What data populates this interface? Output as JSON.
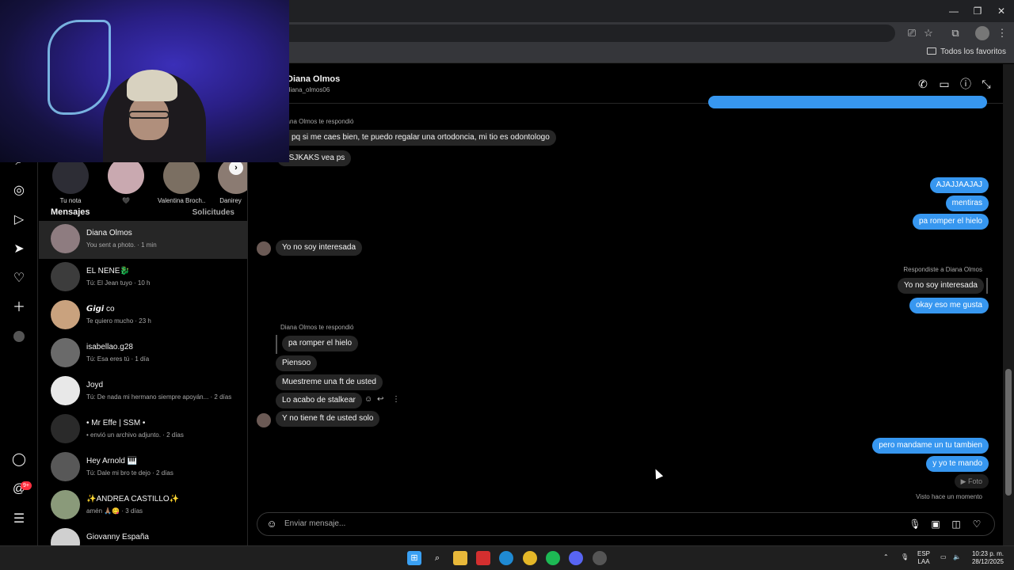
{
  "browser": {
    "bookmarks_folder": "Todos los favoritos"
  },
  "notes": [
    {
      "label": "Tu nota"
    },
    {
      "label": "🖤"
    },
    {
      "label": "Valentina Broch..."
    },
    {
      "label": "Danirey"
    }
  ],
  "sidebar": {
    "messages_title": "Mensajes",
    "requests_label": "Solicitudes",
    "notifications_badge": "9+",
    "conversations": [
      {
        "name": "Diana Olmos",
        "preview": "You sent a photo. · 1 min"
      },
      {
        "name": "EL NENE🐉",
        "preview": "Tú: El Jean tuyo · 10 h"
      },
      {
        "name": "𝙂𝙞𝙜𝙞 co",
        "preview": "Te quiero mucho · 23 h"
      },
      {
        "name": "isabellao.g28",
        "preview": "Tú: Esa eres tú · 1 día"
      },
      {
        "name": "Joyd",
        "preview": "Tú: De nada mi hermano siempre apoyán... · 2 días"
      },
      {
        "name": "• Mr Effe | SSM •",
        "preview": "• envió un archivo adjunto. · 2 días"
      },
      {
        "name": "Hey Arnold 🎹",
        "preview": "Tú: Dale mi bro te dejo · 2 días"
      },
      {
        "name": "✨ANDREA CASTILLO✨",
        "preview": "amén 🙏🏽😋 · 3 días"
      },
      {
        "name": "Giovanny España",
        "preview": ""
      }
    ]
  },
  "chat": {
    "name": "Diana Olmos",
    "username": "diana_olmos06",
    "replied_you_1": "Diana Olmos te respondió",
    "messages": {
      "m1": "si pq si me caes bien, te puedo regalar una ortodoncia, mi tio es odontologo",
      "m2": "KSJKAKS vea ps",
      "m3": "AJAJJAAJAJ",
      "m4": "mentiras",
      "m5": "pa romper el hielo",
      "m6": "Yo no soy interesada",
      "replied_to": "Respondiste a Diana Olmos",
      "m7_quote": "Yo no soy interesada",
      "m8": "okay eso me gusta",
      "replied_you_2": "Diana Olmos te respondió",
      "m9_quote": "pa romper el hielo",
      "m10": "Piensoo",
      "m11": "Muestreme una ft de usted",
      "m12": "Lo acabo de stalkear",
      "m13": "Y no tiene ft de usted solo",
      "m14": "pero mandame un tu tambien",
      "m15": "y yo te mando",
      "photo_label": "▶ Foto",
      "seen": "Visto hace un momento"
    },
    "composer_placeholder": "Enviar mensaje..."
  },
  "taskbar": {
    "lang_top": "ESP",
    "lang_bottom": "LAA",
    "time": "10:23 p. m.",
    "date": "28/12/2025"
  }
}
